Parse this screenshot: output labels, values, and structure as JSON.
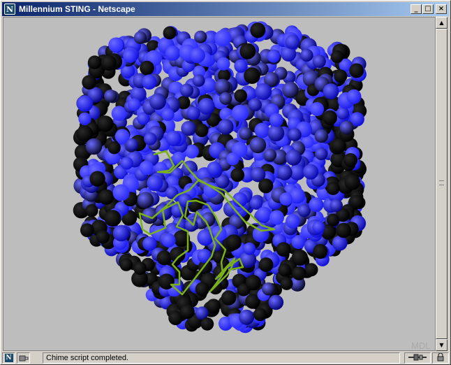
{
  "window": {
    "title": "Millennium STING - Netscape",
    "logo_letter": "N"
  },
  "title_buttons": {
    "minimize": "_",
    "maximize": "□",
    "close": "×"
  },
  "viewer": {
    "watermark": "MDL",
    "background": "#bdbdbd",
    "atom_colors": [
      "#000000",
      "#0a0a30",
      "#050580",
      "#0a0ab0",
      "#1010d8",
      "#1e1ef0",
      "#2a2aff"
    ],
    "backbone_color": "#7ab018"
  },
  "scrollbar": {
    "up_arrow": "▲",
    "down_arrow": "▼"
  },
  "status": {
    "netscape_icon": "N",
    "security_icon": "lock-icon",
    "text": "Chime script completed.",
    "connection_icon": "connection-icon",
    "lock_icon": "padlock-icon"
  }
}
